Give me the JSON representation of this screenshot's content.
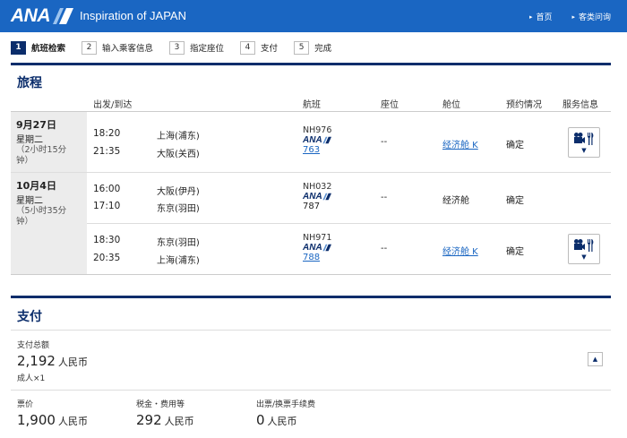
{
  "header": {
    "logo_text": "ANA",
    "tagline": "Inspiration of JAPAN",
    "links": [
      {
        "label": "首页"
      },
      {
        "label": "客类问询"
      }
    ],
    "bg_color": "#1a66c2"
  },
  "steps": [
    {
      "num": "1",
      "label": "航班检索",
      "active": true
    },
    {
      "num": "2",
      "label": "输入乘客信息",
      "active": false
    },
    {
      "num": "3",
      "label": "指定座位",
      "active": false
    },
    {
      "num": "4",
      "label": "支付",
      "active": false
    },
    {
      "num": "5",
      "label": "完成",
      "active": false
    }
  ],
  "itinerary": {
    "title": "旅程",
    "columns": {
      "depart_arrive": "出发/到达",
      "flight": "航班",
      "seat": "座位",
      "cabin": "舱位",
      "booking_status": "预约情况",
      "service_info": "服务信息"
    },
    "days": [
      {
        "date": "9月27日",
        "weekday": "星期二",
        "duration_line1": "（2小时15分",
        "duration_line2": "钟）"
      },
      {
        "date": "10月4日",
        "weekday": "星期二",
        "duration_line1": "（5小时35分",
        "duration_line2": "钟）"
      }
    ],
    "segments": [
      {
        "dep_time": "18:20",
        "dep_city": "上海(浦东)",
        "arr_time": "21:35",
        "arr_city": "大阪(关西)",
        "flight_no": "NH976",
        "carrier": "ANA",
        "aircraft": "763",
        "seat": "--",
        "cabin": "经济舱 K",
        "status": "确定"
      },
      {
        "dep_time": "16:00",
        "dep_city": "大阪(伊丹)",
        "arr_time": "17:10",
        "arr_city": "东京(羽田)",
        "flight_no": "NH032",
        "carrier": "ANA",
        "aircraft": "787",
        "seat": "--",
        "cabin": "经济舱",
        "status": "确定"
      },
      {
        "dep_time": "18:30",
        "dep_city": "东京(羽田)",
        "arr_time": "20:35",
        "arr_city": "上海(浦东)",
        "flight_no": "NH971",
        "carrier": "ANA",
        "aircraft": "788",
        "seat": "--",
        "cabin": "经济舱 K",
        "status": "确定"
      }
    ]
  },
  "payment": {
    "title": "支付",
    "total_label": "支付总额",
    "total_value": "2,192",
    "total_currency": "人民币",
    "passengers": "成人×1",
    "fare_label": "票价",
    "fare_value": "1,900",
    "fare_currency": "人民币",
    "tax_label": "税金・费用等",
    "tax_value": "292",
    "tax_currency": "人民币",
    "fee_label": "出票/换票手续费",
    "fee_value": "0",
    "fee_currency": "人民币"
  },
  "colors": {
    "brand_blue": "#1a66c2",
    "navy": "#0b2d6b",
    "link": "#1a66c2"
  },
  "icons": [
    "ana-logo-mark",
    "chevron-right-icon",
    "entertainment-meal-icon",
    "chevron-down-icon",
    "chevron-up-icon"
  ]
}
